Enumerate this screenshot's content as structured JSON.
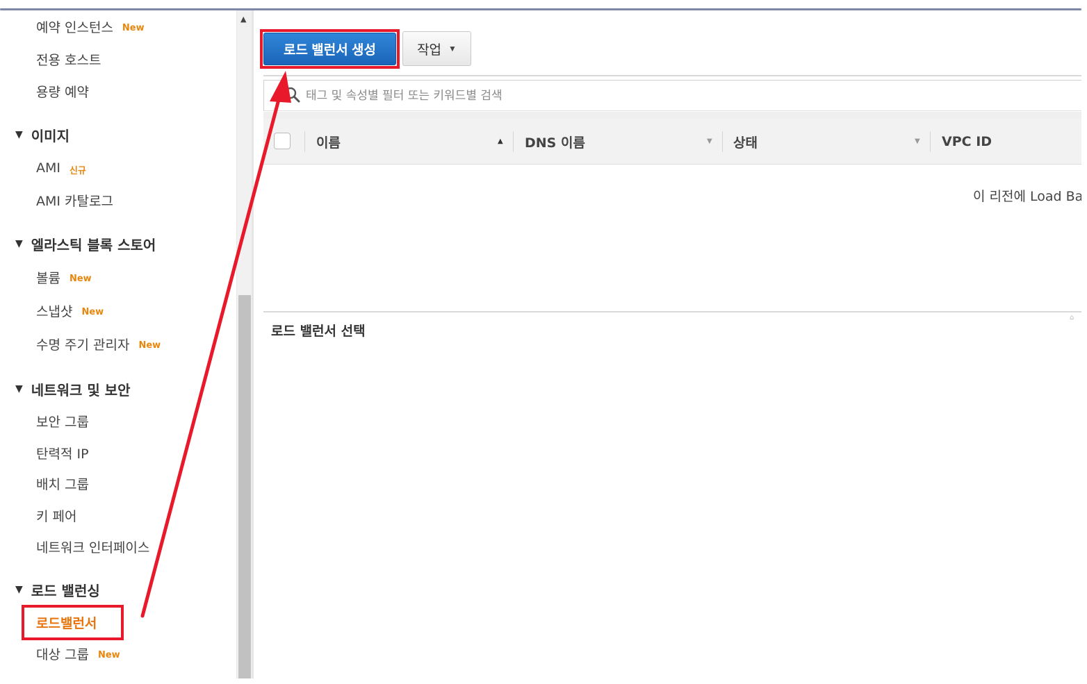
{
  "sidebar": {
    "items": [
      {
        "label": "예약 인스턴스",
        "badge": "New"
      },
      {
        "label": "전용 호스트",
        "badge": ""
      },
      {
        "label": "용량 예약",
        "badge": ""
      }
    ],
    "sections": [
      {
        "title": "이미지",
        "items": [
          {
            "label": "AMI",
            "badge": "신규"
          },
          {
            "label": "AMI 카탈로그",
            "badge": ""
          }
        ]
      },
      {
        "title": "엘라스틱 블록 스토어",
        "items": [
          {
            "label": "볼륨",
            "badge": "New"
          },
          {
            "label": "스냅샷",
            "badge": "New"
          },
          {
            "label": "수명 주기 관리자",
            "badge": "New"
          }
        ]
      },
      {
        "title": "네트워크 및 보안",
        "items": [
          {
            "label": "보안 그룹",
            "badge": ""
          },
          {
            "label": "탄력적 IP",
            "badge": ""
          },
          {
            "label": "배치 그룹",
            "badge": ""
          },
          {
            "label": "키 페어",
            "badge": ""
          },
          {
            "label": "네트워크 인터페이스",
            "badge": ""
          }
        ]
      },
      {
        "title": "로드 밸런싱",
        "items": [
          {
            "label": "로드밸런서",
            "badge": "",
            "active": true
          },
          {
            "label": "대상 그룹",
            "badge": "New"
          }
        ]
      }
    ]
  },
  "toolbar": {
    "create_label": "로드 밸런서 생성",
    "actions_label": "작업"
  },
  "search": {
    "placeholder": "태그 및 속성별 필터 또는 키워드별 검색"
  },
  "table": {
    "columns": [
      "이름",
      "DNS 이름",
      "상태",
      "VPC ID"
    ],
    "empty_message": "이 리전에 Load Ba"
  },
  "detail": {
    "title": "로드 밸런서 선택"
  },
  "colors": {
    "primary_button": "#1f6fc5",
    "badge": "#e8870e",
    "active_nav": "#e8740e",
    "annotation": "#e8192a"
  }
}
